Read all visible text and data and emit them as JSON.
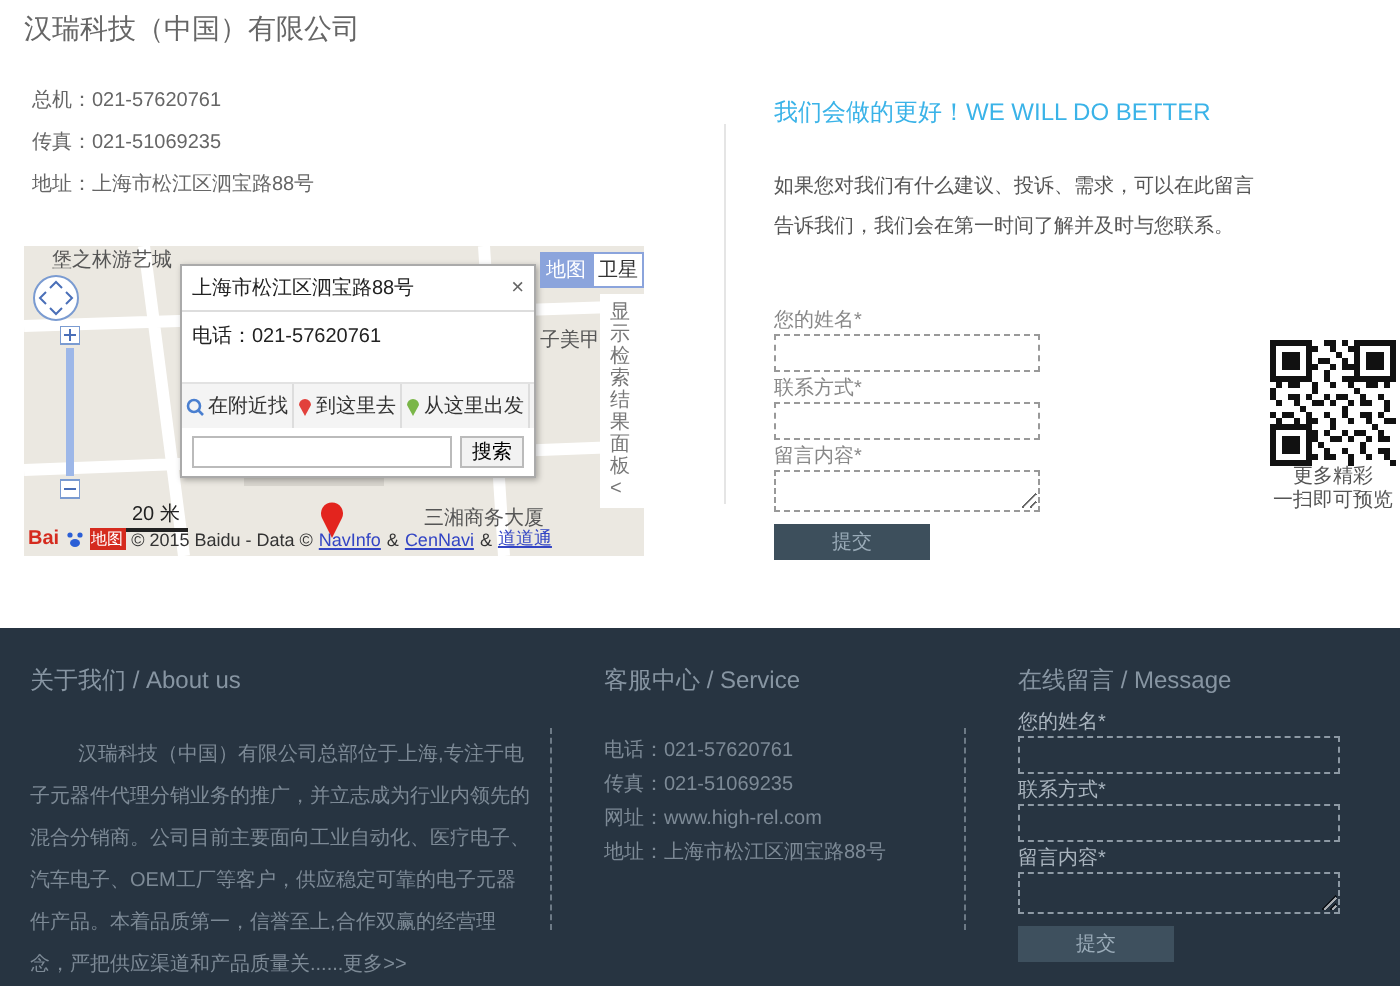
{
  "header": {
    "title": "汉瑞科技（中国）有限公司"
  },
  "contact": [
    "总机：021-57620761",
    "传真：021-51069235",
    "地址：上海市松江区泗宝路88号"
  ],
  "map": {
    "labels": [
      "堡之林游艺城",
      "子美甲",
      "三湘商务大厦"
    ],
    "popup": {
      "title": "上海市松江区泗宝路88号",
      "close": "×",
      "phone": "电话：021-57620761",
      "actions": [
        {
          "kind": "search",
          "label": "在附近找"
        },
        {
          "kind": "to",
          "label": "到这里去"
        },
        {
          "kind": "from",
          "label": "从这里出发"
        }
      ],
      "search_button": "搜索"
    },
    "map_types": [
      {
        "label": "地图",
        "selected": true
      },
      {
        "label": "卫星",
        "selected": false
      }
    ],
    "side_panel": "显示检索结果面板<",
    "scale": "20 米",
    "logo_text": "Bai",
    "logo_suffix": "地图",
    "copyright": [
      {
        "text": "© 2015 Baidu - Data ©",
        "link": false
      },
      {
        "text": "NavInfo",
        "link": true
      },
      {
        "text": "&",
        "link": false
      },
      {
        "text": "CenNavi",
        "link": true
      },
      {
        "text": "&",
        "link": false
      },
      {
        "text": "道道通",
        "link": true
      }
    ]
  },
  "feedback": {
    "heading": "我们会做的更好！WE WILL DO BETTER",
    "text": "如果您对我们有什么建议、投诉、需求，可以在此留言告诉我们，我们会在第一时间了解并及时与您联系。",
    "fields": [
      {
        "kind": "input",
        "label": "您的姓名*"
      },
      {
        "kind": "input",
        "label": "联系方式*"
      },
      {
        "kind": "textarea",
        "label": "留言内容*"
      }
    ],
    "submit": "提交",
    "qr_caption": [
      "更多精彩",
      "一扫即可预览"
    ]
  },
  "footer": {
    "about": {
      "title": "关于我们 / About us",
      "text": "汉瑞科技（中国）有限公司总部位于上海,专注于电子元器件代理分销业务的推广，并立志成为行业内领先的混合分销商。公司目前主要面向工业自动化、医疗电子、汽车电子、OEM工厂等客户，供应稳定可靠的电子元器件产品。本着品质第一，信誉至上,合作双赢的经营理念，严把供应渠道和产品质量关......",
      "more": "更多>>"
    },
    "service": {
      "title": "客服中心 / Service",
      "lines": [
        "电话：021-57620761",
        "传真：021-51069235",
        "网址：www.high-rel.com",
        "地址：上海市松江区泗宝路88号"
      ]
    },
    "message": {
      "title": "在线留言 / Message",
      "fields": [
        {
          "kind": "input",
          "label": "您的姓名*"
        },
        {
          "kind": "input",
          "label": "联系方式*"
        },
        {
          "kind": "textarea",
          "label": "留言内容*"
        }
      ],
      "submit": "提交"
    }
  }
}
